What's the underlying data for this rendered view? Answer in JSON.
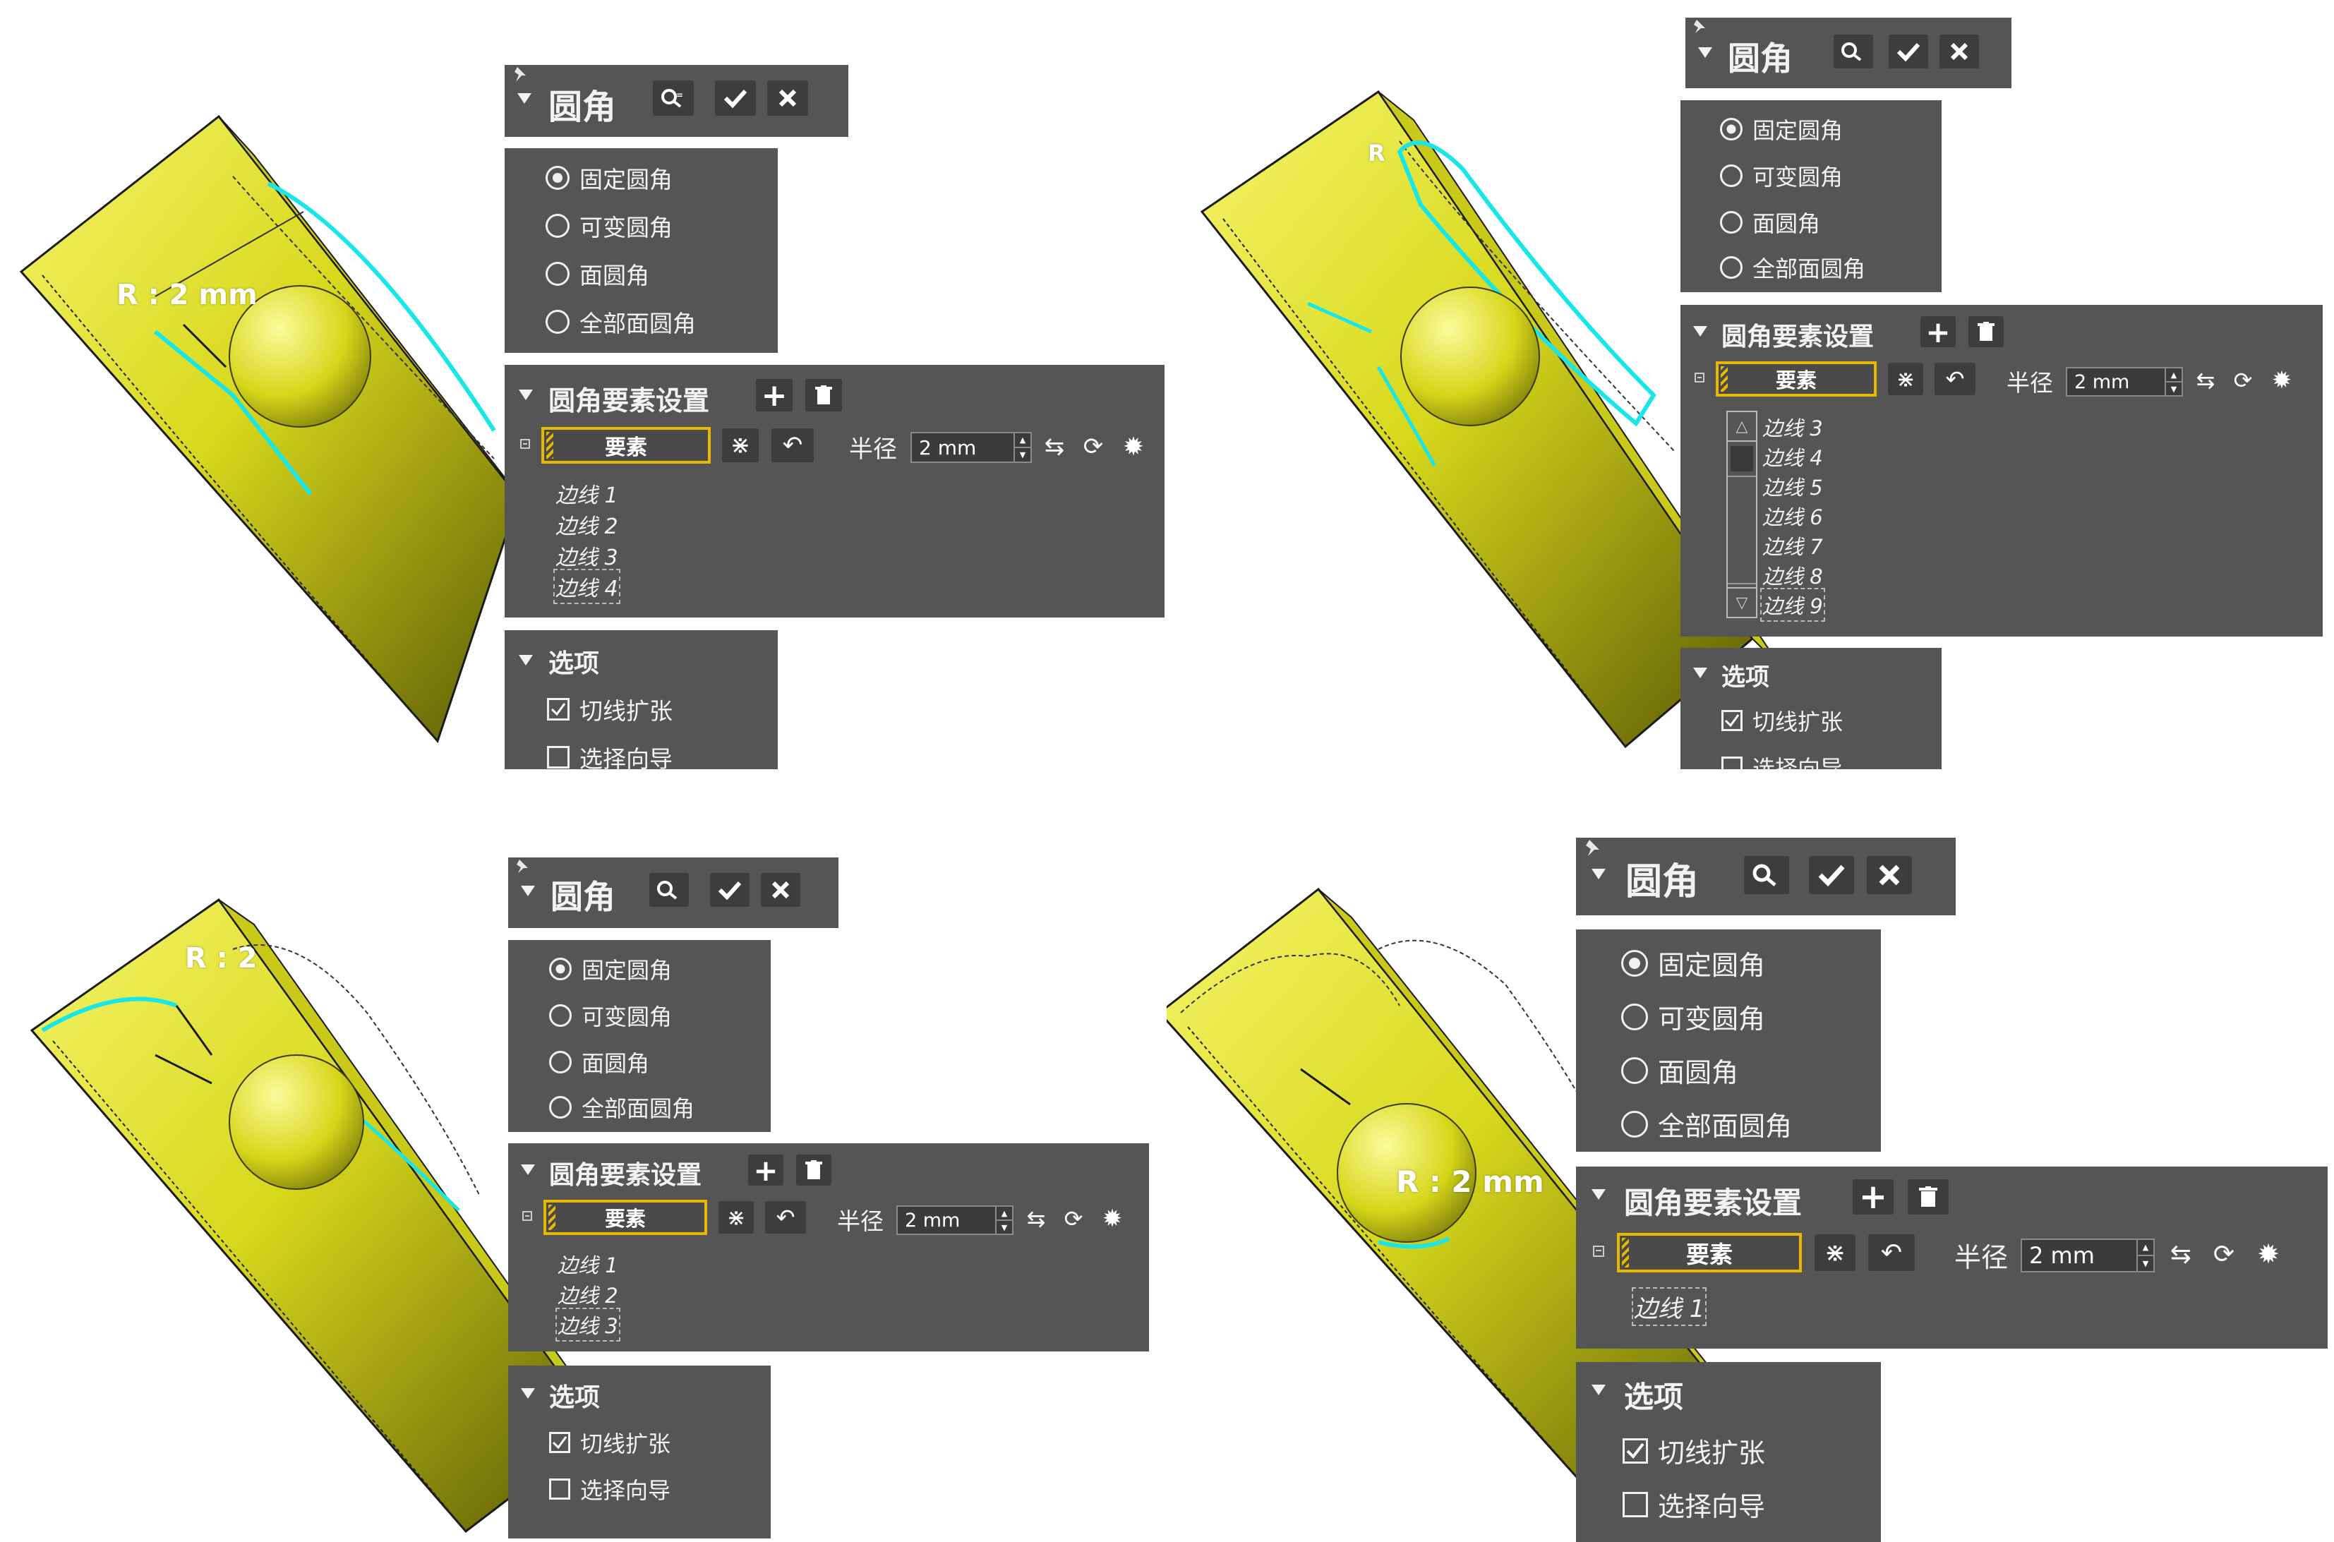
{
  "ui": {
    "dialog_title": "圆角",
    "fillet_types": [
      "固定圆角",
      "可变圆角",
      "面圆角",
      "全部面圆角"
    ],
    "settings_title": "圆角要素设置",
    "element_label": "要素",
    "radius_label": "半径",
    "radius_value": "2 mm",
    "options_title": "选项",
    "option_tangent": "切线扩张",
    "option_guide": "选择向导",
    "selected_fillet_type": "固定圆角",
    "tangent_checked": true,
    "guide_checked": false
  },
  "views": [
    {
      "radius_annotation": "R : 2 mm",
      "edges": [
        "边线 1",
        "边线 2",
        "边线 3",
        "边线 4"
      ],
      "selected_edge": "边线 4"
    },
    {
      "radius_annotation": "R",
      "edges": [
        "边线 3",
        "边线 4",
        "边线 5",
        "边线 6",
        "边线 7",
        "边线 8",
        "边线 9"
      ],
      "selected_edge": "边线 9",
      "has_scrollbar": true
    },
    {
      "radius_annotation": "R : 2",
      "edges": [
        "边线 1",
        "边线 2",
        "边线 3"
      ],
      "selected_edge": "边线 3"
    },
    {
      "radius_annotation": "R : 2 mm",
      "edges": [
        "边线 1"
      ],
      "selected_edge": "边线 1"
    }
  ],
  "colors": {
    "panel_bg": "#555555",
    "button_bg": "#3d3d3d",
    "element_border": "#e8b800",
    "model_yellow": "#e6e62a",
    "selected_edge_cyan": "#19e6e6"
  }
}
